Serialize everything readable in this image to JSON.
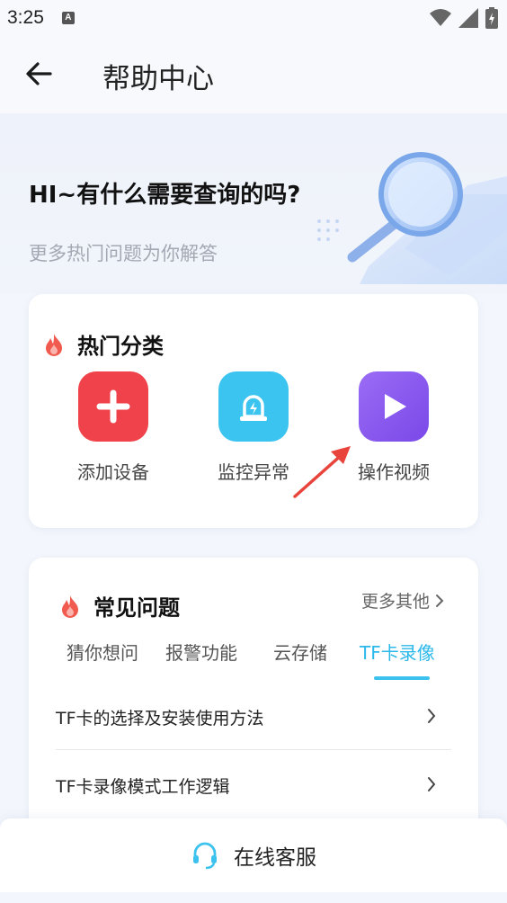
{
  "status_bar": {
    "time": "3:25",
    "indicator": "A",
    "icons": [
      "wifi-icon",
      "signal-icon",
      "battery-icon"
    ]
  },
  "header": {
    "title": "帮助中心",
    "back_icon": "arrow-left-icon"
  },
  "hero": {
    "title": "HI~有什么需要查询的吗?",
    "subtitle": "更多热门问题为你解答"
  },
  "hot_categories": {
    "title": "热门分类",
    "items": [
      {
        "label": "添加设备",
        "icon": "plus-icon",
        "color": "#f0424a"
      },
      {
        "label": "监控异常",
        "icon": "alarm-light-icon",
        "color": "#3cc4f0"
      },
      {
        "label": "操作视频",
        "icon": "play-icon",
        "color": "#8b5cf0"
      }
    ]
  },
  "faq": {
    "title": "常见问题",
    "more_label": "更多其他",
    "tabs": [
      {
        "label": "猜你想问",
        "active": false
      },
      {
        "label": "报警功能",
        "active": false
      },
      {
        "label": "云存储",
        "active": false
      },
      {
        "label": "TF卡录像",
        "active": true
      }
    ],
    "questions": [
      "TF卡的选择及安装使用方法",
      "TF卡录像模式工作逻辑"
    ]
  },
  "bottom": {
    "label": "在线客服",
    "icon": "headset-icon"
  },
  "colors": {
    "accent": "#2bb8ea",
    "flame": "#f05a4f",
    "annotation_arrow": "#e8443c"
  }
}
